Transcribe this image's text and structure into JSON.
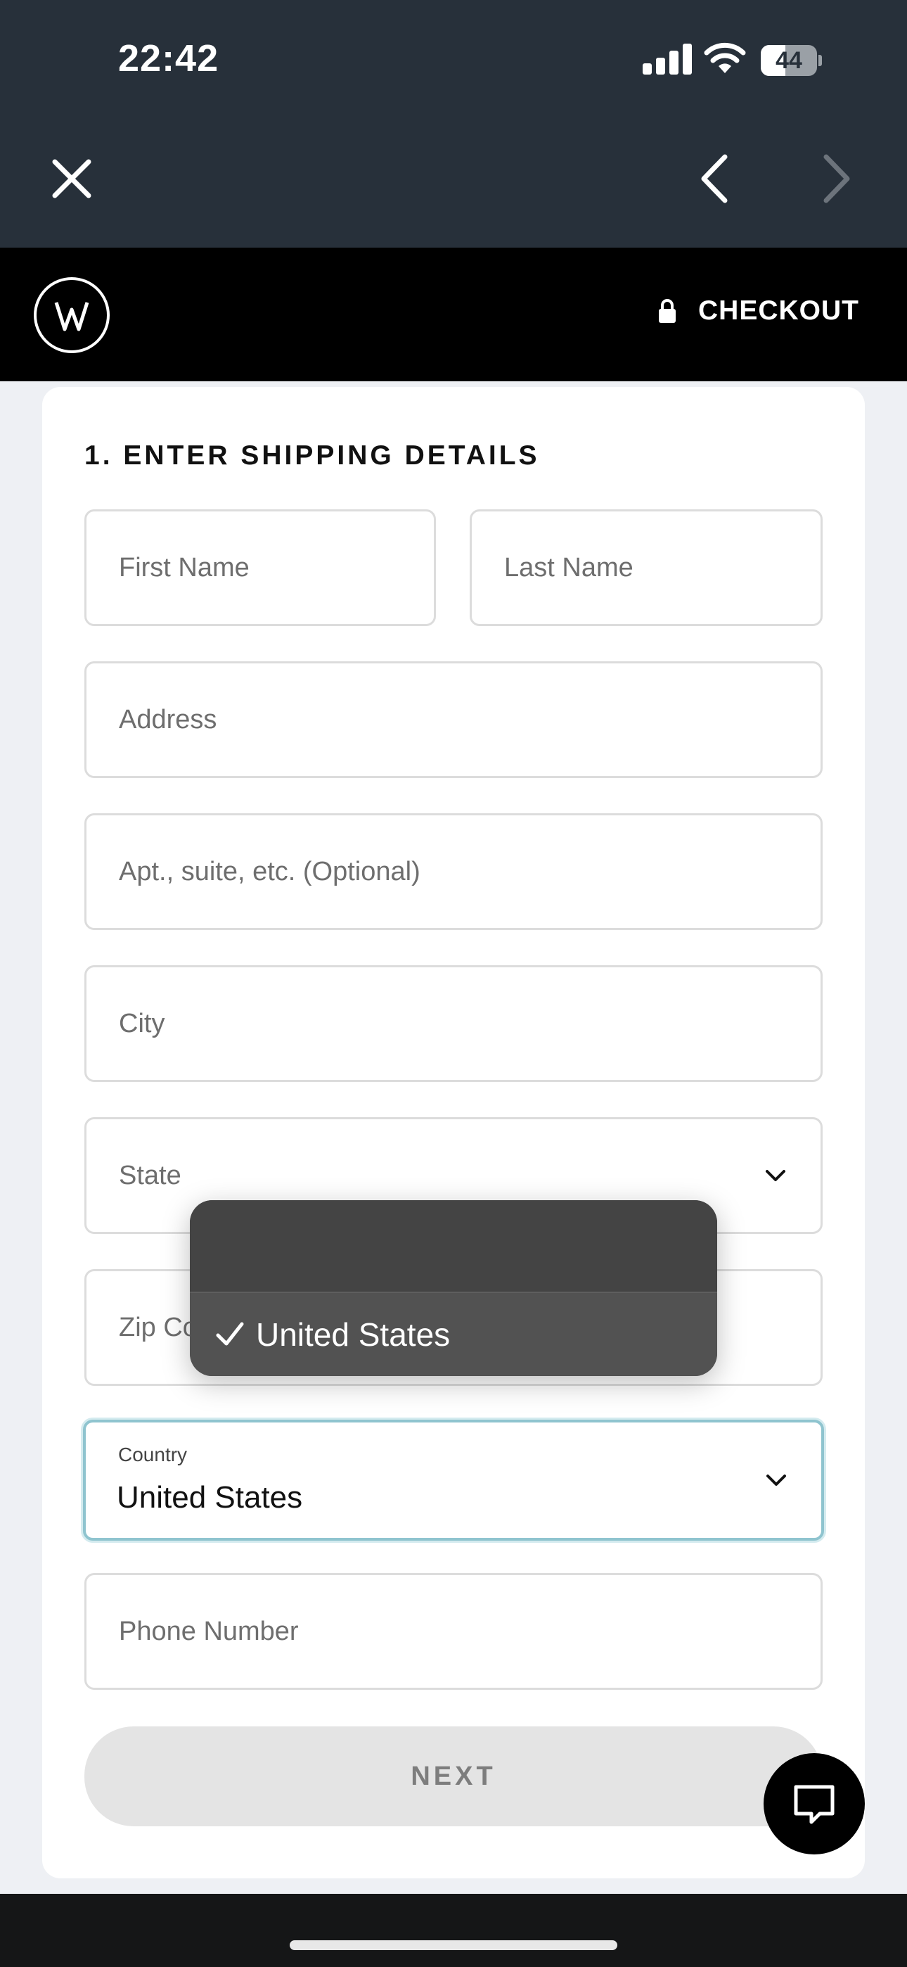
{
  "status_bar": {
    "time": "22:42",
    "battery": "44",
    "battery_level": 0.44
  },
  "browser": {
    "close_icon": "close-icon",
    "back_icon": "chevron-left-icon",
    "forward_icon": "chevron-right-icon"
  },
  "header": {
    "logo": "W",
    "checkout_label": "CHECKOUT",
    "lock_icon": "lock-icon"
  },
  "form": {
    "title": "1. ENTER SHIPPING DETAILS",
    "first_name_placeholder": "First Name",
    "last_name_placeholder": "Last Name",
    "address_placeholder": "Address",
    "apt_placeholder": "Apt., suite, etc. (Optional)",
    "city_placeholder": "City",
    "state_placeholder": "State",
    "zip_placeholder": "Zip Code",
    "country_label": "Country",
    "country_value": "United States",
    "phone_placeholder": "Phone Number",
    "next_label": "NEXT"
  },
  "picker": {
    "options": [
      "",
      "United States"
    ],
    "selected": "United States"
  },
  "chat": {
    "icon": "chat-icon"
  },
  "colors": {
    "focus": "#8fc4cf",
    "header_bg": "#000000",
    "chrome_bg": "#27303a"
  }
}
